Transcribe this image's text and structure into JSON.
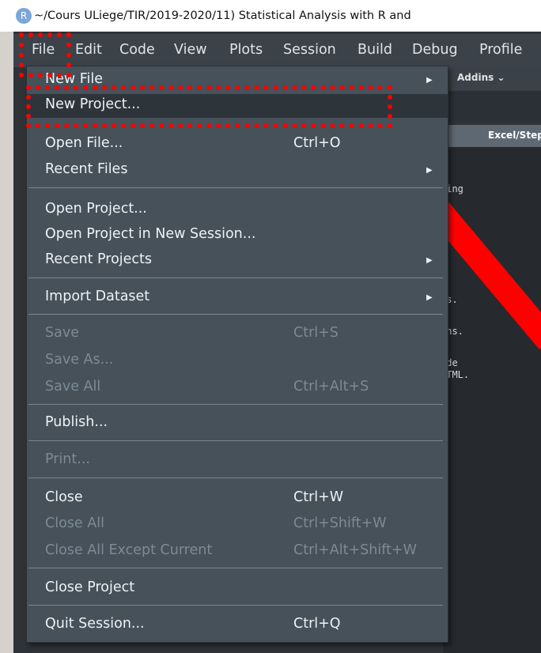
{
  "window": {
    "logo_letter": "R",
    "title": "~/Cours ULiege/TIR/2019-2020/11) Statistical Analysis with R and"
  },
  "menubar": [
    "File",
    "Edit",
    "Code",
    "View",
    "Plots",
    "Session",
    "Build",
    "Debug",
    "Profile"
  ],
  "toolbar": {
    "addins_label": "Addins ⌄"
  },
  "editor": {
    "tab_label": "Excel/Step",
    "code_fragments": [
      "ting",
      "rs.",
      "ons.",
      "ide",
      "HTML."
    ]
  },
  "file_menu": {
    "items": [
      {
        "label": "New File",
        "shortcut": "",
        "submenu": true,
        "enabled": true
      },
      {
        "label": "New Project...",
        "shortcut": "",
        "submenu": false,
        "enabled": true,
        "highlighted": true
      },
      {
        "label": "Open File...",
        "shortcut": "Ctrl+O",
        "submenu": false,
        "enabled": true
      },
      {
        "label": "Recent Files",
        "shortcut": "",
        "submenu": true,
        "enabled": true
      },
      {
        "label": "Open Project...",
        "shortcut": "",
        "submenu": false,
        "enabled": true
      },
      {
        "label": "Open Project in New Session...",
        "shortcut": "",
        "submenu": false,
        "enabled": true
      },
      {
        "label": "Recent Projects",
        "shortcut": "",
        "submenu": true,
        "enabled": true
      },
      {
        "label": "Import Dataset",
        "shortcut": "",
        "submenu": true,
        "enabled": true
      },
      {
        "label": "Save",
        "shortcut": "Ctrl+S",
        "submenu": false,
        "enabled": false
      },
      {
        "label": "Save As...",
        "shortcut": "",
        "submenu": false,
        "enabled": false
      },
      {
        "label": "Save All",
        "shortcut": "Ctrl+Alt+S",
        "submenu": false,
        "enabled": false
      },
      {
        "label": "Publish...",
        "shortcut": "",
        "submenu": false,
        "enabled": true
      },
      {
        "label": "Print...",
        "shortcut": "",
        "submenu": false,
        "enabled": false
      },
      {
        "label": "Close",
        "shortcut": "Ctrl+W",
        "submenu": false,
        "enabled": true
      },
      {
        "label": "Close All",
        "shortcut": "Ctrl+Shift+W",
        "submenu": false,
        "enabled": false
      },
      {
        "label": "Close All Except Current",
        "shortcut": "Ctrl+Alt+Shift+W",
        "submenu": false,
        "enabled": false
      },
      {
        "label": "Close Project",
        "shortcut": "",
        "submenu": false,
        "enabled": true
      },
      {
        "label": "Quit Session...",
        "shortcut": "Ctrl+Q",
        "submenu": false,
        "enabled": true
      }
    ]
  },
  "colors": {
    "menu_background": "#46515a",
    "highlight_background": "#2d343a",
    "disabled_text": "#7c8b96",
    "annotation_red": "#ff0000"
  }
}
